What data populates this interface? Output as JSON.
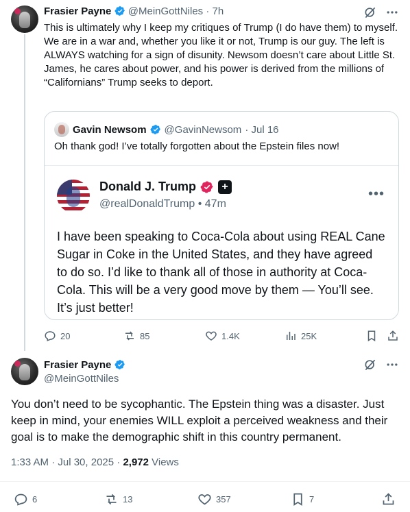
{
  "post1": {
    "author_name": "Frasier Payne",
    "handle": "@MeinGottNiles",
    "time": "· 7h",
    "paragraphs": [
      "This is ultimately why I keep my critiques of Trump (I do have them) to myself.",
      "We are in a war and, whether you like it or not, Trump is our guy. The left is ALWAYS watching for a sign of disunity. Newsom doesn’t care about Little St. James, he cares about power, and his power is derived from the millions of “Californians” Trump seeks to deport."
    ],
    "quote": {
      "author_name": "Gavin Newsom",
      "handle": "@GavinNewsom",
      "time": "· Jul 16",
      "text": "Oh thank god! I’ve totally forgotten about the Epstein files now!",
      "embed": {
        "author_name": "Donald J. Trump",
        "handle": "@realDonaldTrump",
        "time": "• 47m",
        "text": "I have been speaking to Coca-Cola about using REAL Cane Sugar in Coke in the United States, and they have agreed to do so. I’d like to thank all of those in authority at Coca-Cola. This will be a very good move by them — You’ll see. It’s just better!"
      }
    },
    "stats": {
      "replies": "20",
      "reposts": "85",
      "likes": "1.4K",
      "views": "25K"
    }
  },
  "post2": {
    "author_name": "Frasier Payne",
    "handle": "@MeinGottNiles",
    "text": "You don’t need to be sycophantic. The Epstein thing was a disaster. Just keep in mind, your enemies WILL exploit a perceived weakness and their goal is to make the demographic shift in this country permanent.",
    "timestamp": "1:33 AM · Jul 30, 2025 · ",
    "views_count": "2,972",
    "views_label": " Views",
    "stats": {
      "replies": "6",
      "reposts": "13",
      "likes": "357",
      "bookmarks": "7"
    }
  },
  "colors": {
    "verified_blue": "#1d9bf0",
    "truth_badge": "#e0245e",
    "muted": "#536471",
    "border": "#cfd9de"
  },
  "icons": {
    "more": "more-icon",
    "grok": "grok-icon",
    "reply": "reply-icon",
    "repost": "repost-icon",
    "like": "like-icon",
    "views": "views-icon",
    "bookmark": "bookmark-icon",
    "share": "share-icon"
  }
}
